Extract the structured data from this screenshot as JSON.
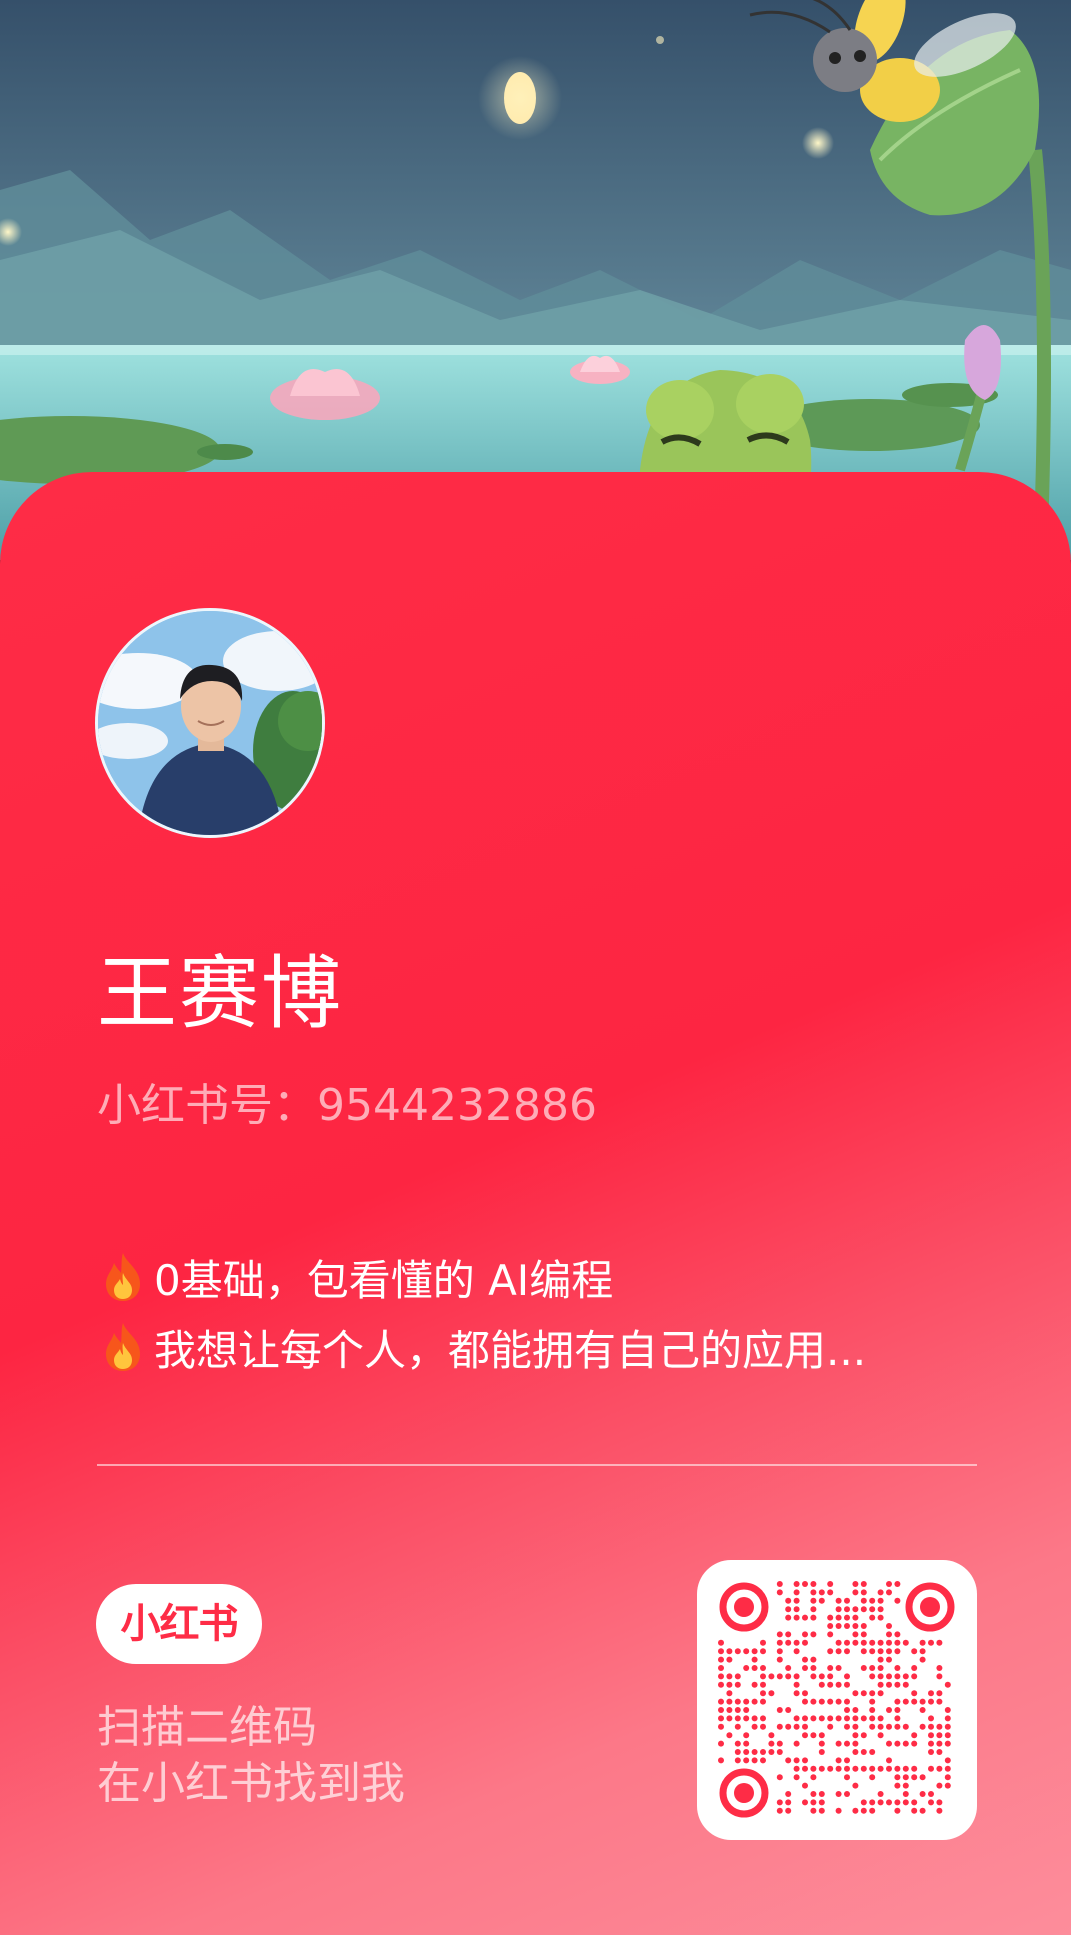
{
  "profile": {
    "name": "王赛博",
    "id_text": "小红书号：9544232886"
  },
  "bio": [
    {
      "icon": "fire-icon",
      "text": "0基础，包看懂的 AI编程"
    },
    {
      "icon": "fire-icon",
      "text": "我想让每个人，都能拥有自己的应用..."
    }
  ],
  "brand": {
    "logo_text": "小红书",
    "color": "#fe2c46"
  },
  "scan": {
    "line1": "扫描二维码",
    "line2": "在小红书找到我"
  },
  "colors": {
    "card_red": "#fe2c46",
    "card_pink": "#fd8d9b",
    "sky": "#3e5c73",
    "lake": "#8fd6d6"
  }
}
